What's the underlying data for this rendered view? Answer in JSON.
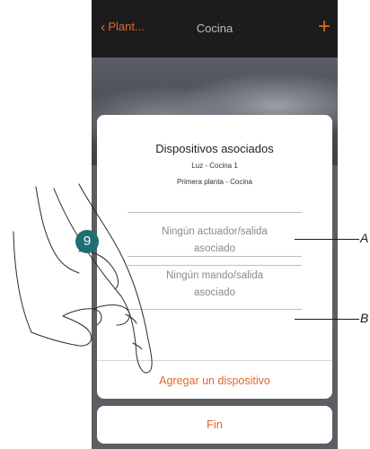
{
  "nav": {
    "back_label": "Plant...",
    "title": "Cocina",
    "add_symbol": "+"
  },
  "dialog": {
    "title": "Dispositivos asociados",
    "subtitle_1": "Luz - Cocina 1",
    "subtitle_2": "Primera planta - Cocina",
    "actuator_slot_line1": "Ningún actuador/salida",
    "actuator_slot_line2": "asociado",
    "command_slot_line1": "Ningún mando/salida",
    "command_slot_line2": "asociado",
    "add_device_label": "Agregar un dispositivo"
  },
  "fin_label": "Fin",
  "step_number": "9",
  "callouts": {
    "a": "A",
    "b": "B"
  },
  "colors": {
    "accent": "#e0672c",
    "step_badge": "#1f6e72"
  }
}
